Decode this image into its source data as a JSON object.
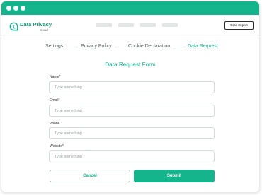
{
  "colors": {
    "accent": "#14b58c",
    "titlebar": "#14b58c"
  },
  "brand": {
    "name": "Data Privacy",
    "sub": "Cloud",
    "icon": "cloud-shield-icon"
  },
  "header": {
    "export_label": "Data Export"
  },
  "steps": [
    {
      "label": "Settings"
    },
    {
      "label": "Privacy Policy"
    },
    {
      "label": "Cookie Declaration"
    },
    {
      "label": "Data Request"
    }
  ],
  "form": {
    "title": "Data Request Form",
    "fields": [
      {
        "label": "Name*",
        "placeholder": "Type something"
      },
      {
        "label": "Email*",
        "placeholder": "Type something"
      },
      {
        "label": "Phone",
        "placeholder": "Type something"
      },
      {
        "label": "Website*",
        "placeholder": "Type something"
      }
    ],
    "cancel_label": "Cancel",
    "submit_label": "Submit"
  }
}
